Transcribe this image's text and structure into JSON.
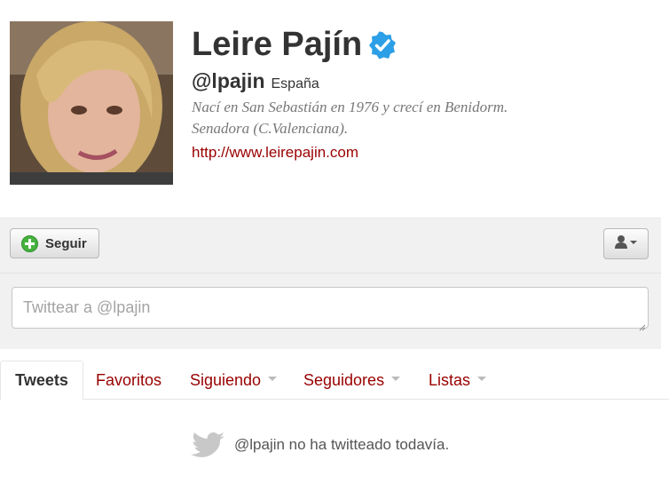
{
  "profile": {
    "name": "Leire Pajín",
    "handle": "@lpajin",
    "location": "España",
    "bio_line1": "Nací en San Sebastián en 1976 y crecí en Benidorm.",
    "bio_line2": "Senadora (C.Valenciana).",
    "url": "http://www.leirepajin.com",
    "verified": true
  },
  "actions": {
    "follow_label": "Seguir",
    "tweet_placeholder": "Twittear a @lpajin"
  },
  "tabs": [
    {
      "label": "Tweets",
      "active": true,
      "has_caret": false
    },
    {
      "label": "Favoritos",
      "active": false,
      "has_caret": false
    },
    {
      "label": "Siguiendo",
      "active": false,
      "has_caret": true
    },
    {
      "label": "Seguidores",
      "active": false,
      "has_caret": true
    },
    {
      "label": "Listas",
      "active": false,
      "has_caret": true
    }
  ],
  "empty_state": {
    "text": "@lpajin no ha twitteado todavía."
  },
  "colors": {
    "link": "#990000",
    "verified": "#1da1f2",
    "follow_icon": "#4bb543"
  },
  "icons": {
    "verified": "verified-badge-icon",
    "follow": "plus-circle-icon",
    "user_menu": "user-dropdown-icon",
    "empty": "twitter-bird-icon"
  }
}
